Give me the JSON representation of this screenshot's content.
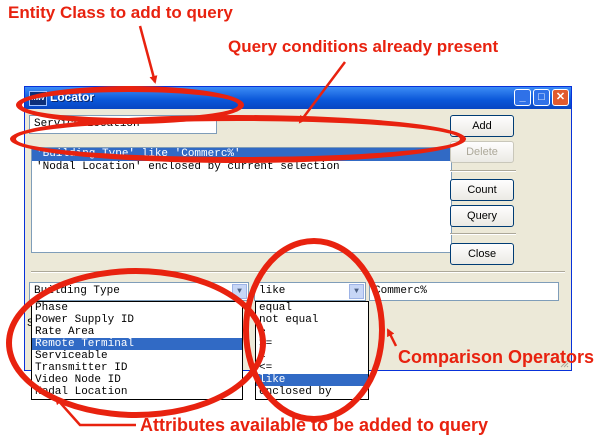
{
  "annotations": {
    "entity_class": "Entity Class to add to query",
    "query_conditions": "Query conditions already present",
    "comparison_operators": "Comparison Operators",
    "attributes_available": "Attributes available to be added to query"
  },
  "window": {
    "title": "Locator",
    "icon_label": "nwv",
    "buttons": {
      "minimize": "_",
      "maximize": "□",
      "close": "✕"
    }
  },
  "entity_field": {
    "value": "Service Location"
  },
  "conditions": [
    {
      "text": "'Building Type' like 'Commerc%'",
      "selected": true
    },
    {
      "text": "'Nodal Location' enclosed by current selection",
      "selected": false
    }
  ],
  "side_buttons": {
    "add": "Add",
    "delete": "Delete",
    "count": "Count",
    "query": "Query",
    "close": "Close"
  },
  "attribute_combo": {
    "value": "Building Type"
  },
  "operator_combo": {
    "value": "like"
  },
  "value_field": {
    "value": "Commerc%"
  },
  "side_label": "S",
  "attribute_list": [
    {
      "label": "Phase",
      "selected": false
    },
    {
      "label": "Power Supply ID",
      "selected": false
    },
    {
      "label": "Rate Area",
      "selected": false
    },
    {
      "label": "Remote Terminal",
      "selected": true
    },
    {
      "label": "Serviceable",
      "selected": false
    },
    {
      "label": "Transmitter ID",
      "selected": false
    },
    {
      "label": "Video Node ID",
      "selected": false
    },
    {
      "label": "Nodal Location",
      "selected": false
    }
  ],
  "operator_list": [
    {
      "label": "equal",
      "selected": false
    },
    {
      "label": "not equal",
      "selected": false
    },
    {
      "label": ">",
      "selected": false
    },
    {
      "label": ">=",
      "selected": false
    },
    {
      "label": "<",
      "selected": false
    },
    {
      "label": "<=",
      "selected": false
    },
    {
      "label": "like",
      "selected": true
    },
    {
      "label": "enclosed by",
      "selected": false
    }
  ],
  "colors": {
    "annotation_red": "#e8220f",
    "selection_blue": "#316ac5",
    "titlebar_blue": "#0a56d8"
  }
}
